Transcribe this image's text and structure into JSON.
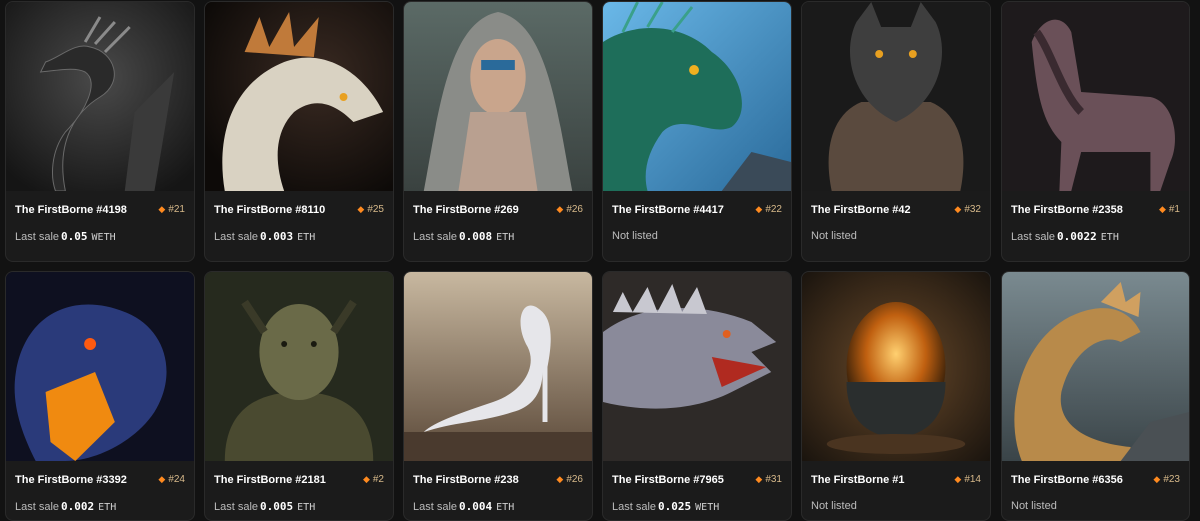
{
  "labels": {
    "last_sale": "Last sale",
    "not_listed": "Not listed"
  },
  "accent_color": "#ff8a1f",
  "cards": [
    {
      "name": "The FirstBorne #4198",
      "rank": "#21",
      "price": "0.05",
      "currency": "WETH",
      "art": "dark-dragon-image"
    },
    {
      "name": "The FirstBorne #8110",
      "rank": "#25",
      "price": "0.003",
      "currency": "ETH",
      "art": "white-dragon-image"
    },
    {
      "name": "The FirstBorne #269",
      "rank": "#26",
      "price": "0.008",
      "currency": "ETH",
      "art": "hooded-woman-image"
    },
    {
      "name": "The FirstBorne #4417",
      "rank": "#22",
      "status": "Not listed",
      "art": "green-dragon-image"
    },
    {
      "name": "The FirstBorne #42",
      "rank": "#32",
      "status": "Not listed",
      "art": "wolf-man-image"
    },
    {
      "name": "The FirstBorne #2358",
      "rank": "#1",
      "price": "0.0022",
      "currency": "ETH",
      "art": "armored-horse-image"
    },
    {
      "name": "The FirstBorne #3392",
      "rank": "#24",
      "price": "0.002",
      "currency": "ETH",
      "art": "fire-dragon-image"
    },
    {
      "name": "The FirstBorne #2181",
      "rank": "#2",
      "price": "0.005",
      "currency": "ETH",
      "art": "goblin-image"
    },
    {
      "name": "The FirstBorne #238",
      "rank": "#26",
      "price": "0.004",
      "currency": "ETH",
      "art": "white-bird-image"
    },
    {
      "name": "The FirstBorne #7965",
      "rank": "#31",
      "price": "0.025",
      "currency": "WETH",
      "art": "spiked-lizard-image"
    },
    {
      "name": "The FirstBorne #1",
      "rank": "#14",
      "status": "Not listed",
      "art": "glowing-egg-image"
    },
    {
      "name": "The FirstBorne #6356",
      "rank": "#23",
      "status": "Not listed",
      "art": "golden-dragon-image"
    }
  ]
}
